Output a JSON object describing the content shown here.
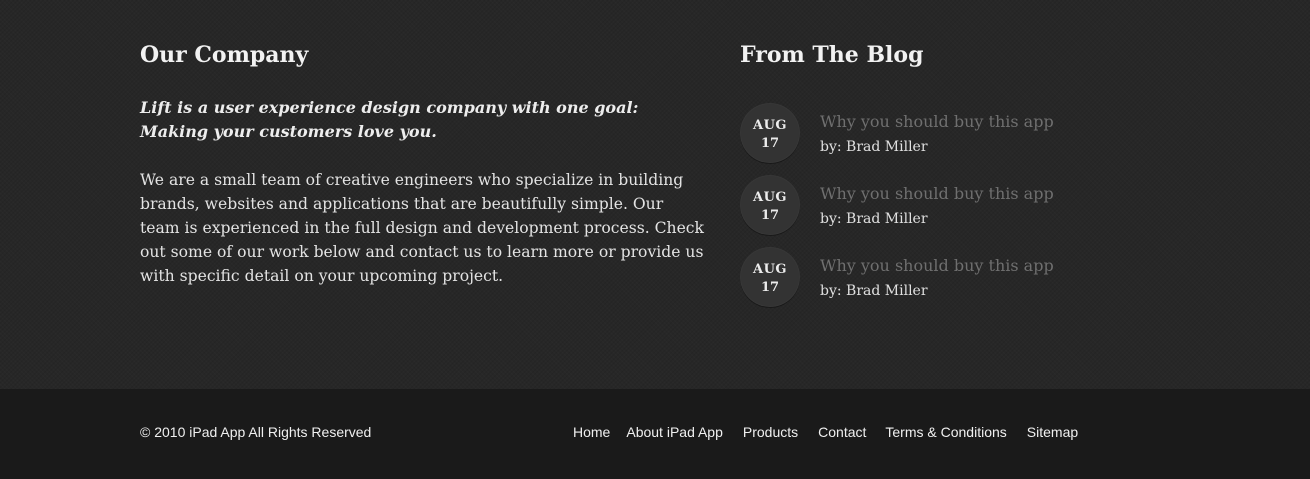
{
  "company": {
    "title": "Our Company",
    "tagline": "Lift is a user experience design company with one goal: Making your customers love you.",
    "body": "We are a small team of creative engineers who specialize in building brands, websites and applications that are beautifully simple. Our team is experienced in the full design and development process. Check out some of our work below and contact us to learn more or provide us with specific detail on your upcoming project."
  },
  "blog": {
    "title": "From The Blog",
    "posts": [
      {
        "month": "AUG",
        "day": "17",
        "title": "Why you should buy this app",
        "author": "by: Brad Miller"
      },
      {
        "month": "AUG",
        "day": "17",
        "title": "Why you should buy this app",
        "author": "by: Brad Miller"
      },
      {
        "month": "AUG",
        "day": "17",
        "title": "Why you should buy this app",
        "author": "by: Brad Miller"
      }
    ]
  },
  "footer": {
    "copyright": "© 2010 iPad App All Rights Reserved",
    "nav": [
      "Home",
      "About iPad App",
      "Products",
      "Contact",
      "Terms & Conditions",
      "Sitemap"
    ]
  },
  "colors": {
    "background": "#262626",
    "footer_background": "#1a1a1a",
    "date_badge": "#333333",
    "post_title": "#6f6f6f",
    "text": "#e6e6e6"
  }
}
